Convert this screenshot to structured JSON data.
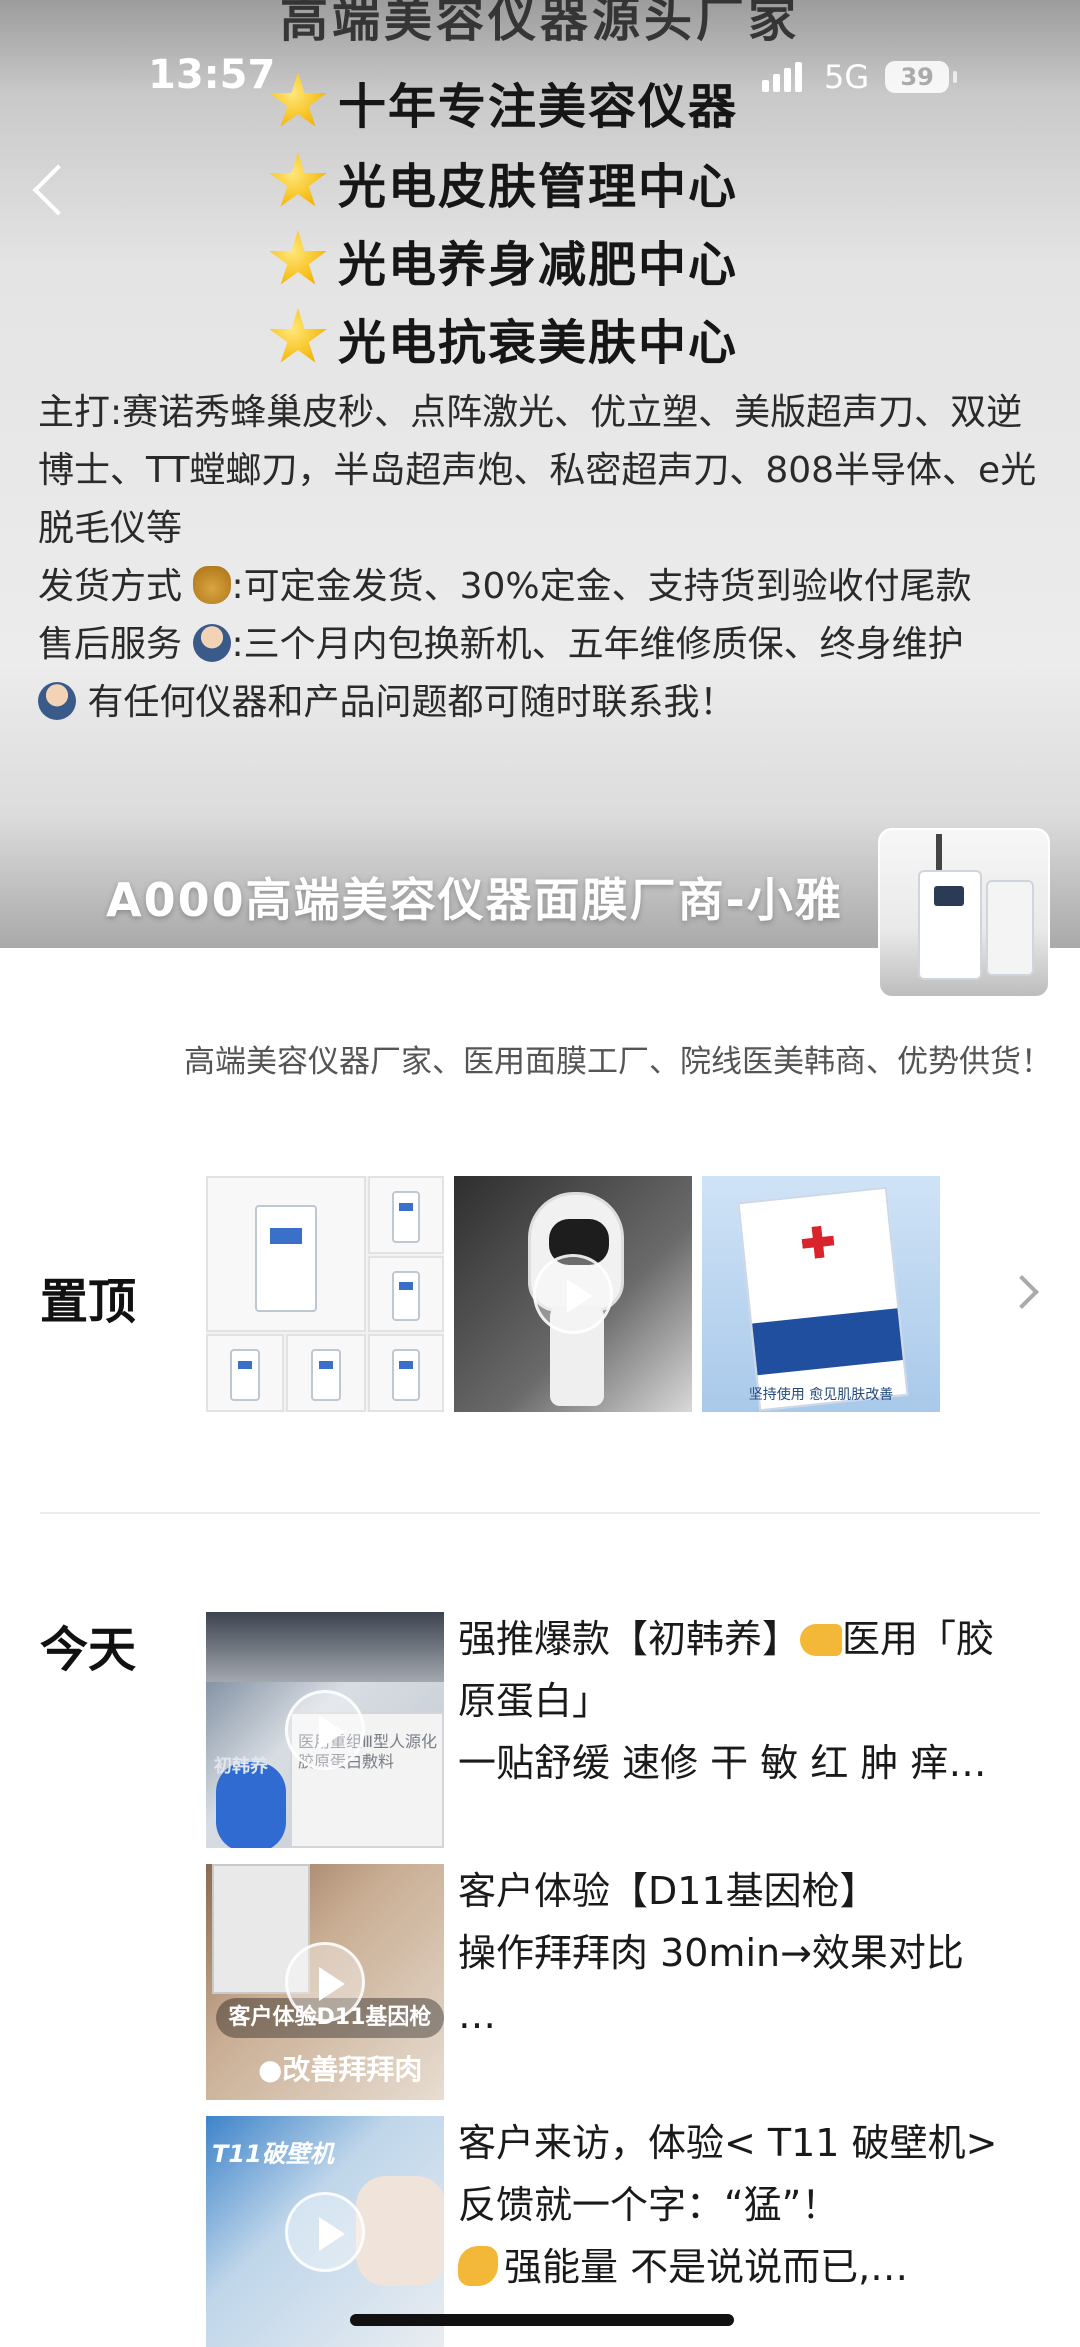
{
  "status_bar": {
    "time": "13:57",
    "network": "5G",
    "battery": "39"
  },
  "cover": {
    "heading_top": "高端美容仪器源头厂家",
    "star_lines": [
      "十年专注美容仪器",
      "光电皮肤管理中心",
      "光电养身减肥中心",
      "光电抗衰美肤中心"
    ],
    "main_products": "主打:赛诺秀蜂巢皮秒、点阵激光、优立塑、美版超声刀、双逆博士、TT螳螂刀，半岛超声炮、私密超声刀、808半导体、e光脱毛仪等",
    "shipping_prefix": "发货方式",
    "shipping_text": ":可定金发货、30%定金、支持货到验收付尾款",
    "aftersale_prefix": "售后服务",
    "aftersale_text": ":三个月内包换新机、五年维修质保、终身维护",
    "contact_text": "有任何仪器和产品问题都可随时联系我！",
    "footer_name": "A000高端美容仪器面膜厂商-小雅"
  },
  "profile": {
    "signature": "高端美容仪器厂家、医用面膜工厂、院线医美韩商、优势供货！"
  },
  "pinned": {
    "label": "置顶",
    "pin3_caption": "坚持使用 愈见肌肤改善"
  },
  "today": {
    "label": "今天",
    "posts": [
      {
        "line1": "强推爆款【初韩养】",
        "line1_after": "医用「胶",
        "line2": "原蛋白」",
        "line3": "一贴舒缓 速修 干 敏 红 肿 痒…",
        "thumb_label": "医用重组Ⅲ型人源化胶原蛋白敷料",
        "thumb_brand": "初韩养"
      },
      {
        "line1": "客户体验【D11基因枪】",
        "line2": "操作拜拜肉 30min→效果对比",
        "line3": "…",
        "thumb_pill": "客户体验D11基因枪",
        "thumb_pill2": "●改善拜拜肉"
      },
      {
        "line1": "客户来访，体验< T11 破壁机>",
        "line2": "反馈就一个字：“猛”！",
        "line3": "强能量 不是说说而已,…",
        "thumb_tag": "T11破壁机"
      }
    ]
  },
  "icons": {
    "back": "back-icon",
    "chevron": "chevron-right-icon",
    "play": "play-icon"
  }
}
